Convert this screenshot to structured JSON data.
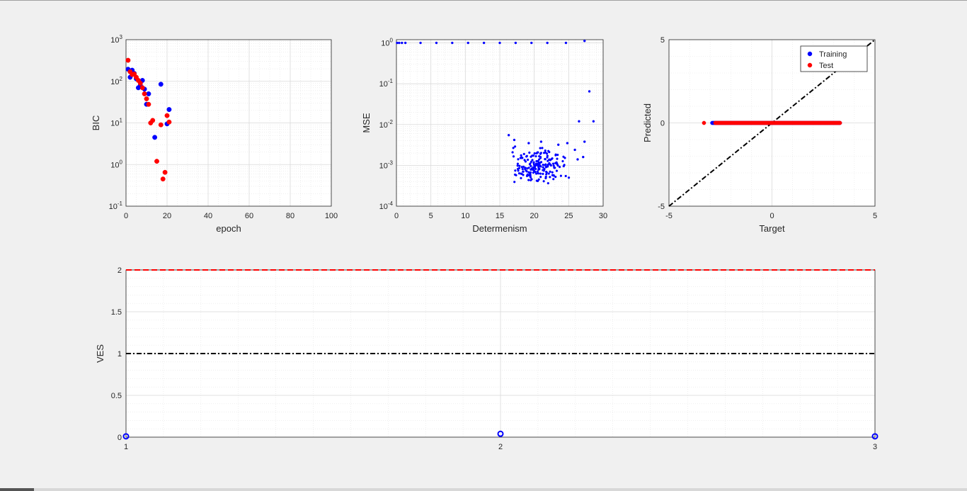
{
  "chart_data": [
    {
      "id": "bic",
      "type": "scatter",
      "xlabel": "epoch",
      "ylabel": "BIC",
      "xlim": [
        0,
        100
      ],
      "ylim": [
        0.1,
        1000
      ],
      "yscale": "log",
      "xticks": [
        "0",
        "20",
        "40",
        "60",
        "80",
        "100"
      ],
      "yticks": [
        {
          "base": "10",
          "exp": "-1",
          "v": 0.1
        },
        {
          "base": "10",
          "exp": "0",
          "v": 1
        },
        {
          "base": "10",
          "exp": "1",
          "v": 10
        },
        {
          "base": "10",
          "exp": "2",
          "v": 100
        },
        {
          "base": "10",
          "exp": "3",
          "v": 1000
        }
      ],
      "grid": true,
      "series": [
        {
          "color": "#0000ff",
          "points": [
            [
              1,
              195
            ],
            [
              2,
              125
            ],
            [
              3,
              185
            ],
            [
              4,
              155
            ],
            [
              5,
              115
            ],
            [
              6,
              70
            ],
            [
              7,
              80
            ],
            [
              8,
              105
            ],
            [
              9,
              65
            ],
            [
              10,
              28
            ],
            [
              11,
              50
            ],
            [
              14,
              4.5
            ],
            [
              17,
              85
            ],
            [
              20,
              9.5
            ],
            [
              21,
              21
            ]
          ]
        },
        {
          "color": "#ff0000",
          "points": [
            [
              1,
              320
            ],
            [
              2,
              170
            ],
            [
              3,
              145
            ],
            [
              4,
              150
            ],
            [
              5,
              125
            ],
            [
              6,
              105
            ],
            [
              7,
              90
            ],
            [
              8,
              70
            ],
            [
              9,
              50
            ],
            [
              10,
              38
            ],
            [
              11,
              28
            ],
            [
              12,
              10
            ],
            [
              13,
              11.5
            ],
            [
              15,
              1.2
            ],
            [
              17,
              9
            ],
            [
              18,
              0.45
            ],
            [
              19,
              0.65
            ],
            [
              20,
              15
            ],
            [
              21,
              10.5
            ]
          ]
        }
      ]
    },
    {
      "id": "mse",
      "type": "scatter",
      "xlabel": "Determenism",
      "ylabel": "MSE",
      "xlim": [
        0,
        30
      ],
      "ylim": [
        0.0001,
        1.2
      ],
      "yscale": "log",
      "xticks": [
        "0",
        "5",
        "10",
        "15",
        "20",
        "25",
        "30"
      ],
      "yticks": [
        {
          "base": "10",
          "exp": "-4",
          "v": 0.0001
        },
        {
          "base": "10",
          "exp": "-3",
          "v": 0.001
        },
        {
          "base": "10",
          "exp": "-2",
          "v": 0.01
        },
        {
          "base": "10",
          "exp": "-1",
          "v": 0.1
        },
        {
          "base": "10",
          "exp": "0",
          "v": 1
        }
      ],
      "grid": true,
      "top_points": [
        [
          0.1,
          1
        ],
        [
          0.4,
          1
        ],
        [
          0.8,
          1
        ],
        [
          1.3,
          1
        ],
        [
          3.5,
          1
        ],
        [
          5.8,
          1
        ],
        [
          8.1,
          1
        ],
        [
          10.4,
          1
        ],
        [
          12.7,
          1
        ],
        [
          15,
          1
        ],
        [
          17.3,
          1
        ],
        [
          19.6,
          1
        ],
        [
          21.9,
          1
        ],
        [
          24.6,
          1
        ],
        [
          27.3,
          1.12
        ]
      ],
      "sparse_points": [
        [
          16.3,
          0.0055
        ],
        [
          17.1,
          0.0042
        ],
        [
          19.2,
          0.0035
        ],
        [
          21,
          0.0038
        ],
        [
          23.5,
          0.0032
        ],
        [
          24.8,
          0.0035
        ],
        [
          25.9,
          0.0024
        ],
        [
          26.5,
          0.012
        ],
        [
          27.3,
          0.0038
        ],
        [
          28,
          0.065
        ],
        [
          28.6,
          0.012
        ],
        [
          26.3,
          0.0014
        ],
        [
          27.1,
          0.0016
        ]
      ],
      "cluster": {
        "x_range": [
          16.2,
          25.2
        ],
        "y_range": [
          0.00035,
          0.0032
        ],
        "count": 190,
        "color": "#0000ff"
      }
    },
    {
      "id": "pred",
      "type": "scatter",
      "xlabel": "Target",
      "ylabel": "Predicted",
      "xlim": [
        -5,
        5
      ],
      "ylim": [
        -5,
        5
      ],
      "xticks": [
        "-5",
        "0",
        "5"
      ],
      "yticks": [
        "-5",
        "0",
        "5"
      ],
      "grid": true,
      "legend_position": "top-right",
      "legend": [
        {
          "label": "Training",
          "color": "#0000ff"
        },
        {
          "label": "Test",
          "color": "#ff0000"
        }
      ],
      "training_x_range": [
        -2.9,
        3.3
      ],
      "test_x_range": [
        -3.3,
        3.3
      ],
      "y_value": 0,
      "identity_line": true
    },
    {
      "id": "ves",
      "type": "line",
      "xlabel": "",
      "ylabel": "VES",
      "xlim": [
        1,
        3
      ],
      "ylim": [
        0,
        2
      ],
      "xticks": [
        "1",
        "2",
        "3"
      ],
      "yticks": [
        "0",
        "0.5",
        "1",
        "1.5",
        "2"
      ],
      "grid": true,
      "red_dashed_y": 2,
      "black_dashdot_y": 1,
      "points": [
        [
          1,
          0.01
        ],
        [
          2,
          0.04
        ],
        [
          3,
          0.01
        ]
      ],
      "point_color": "#0000ff"
    }
  ]
}
